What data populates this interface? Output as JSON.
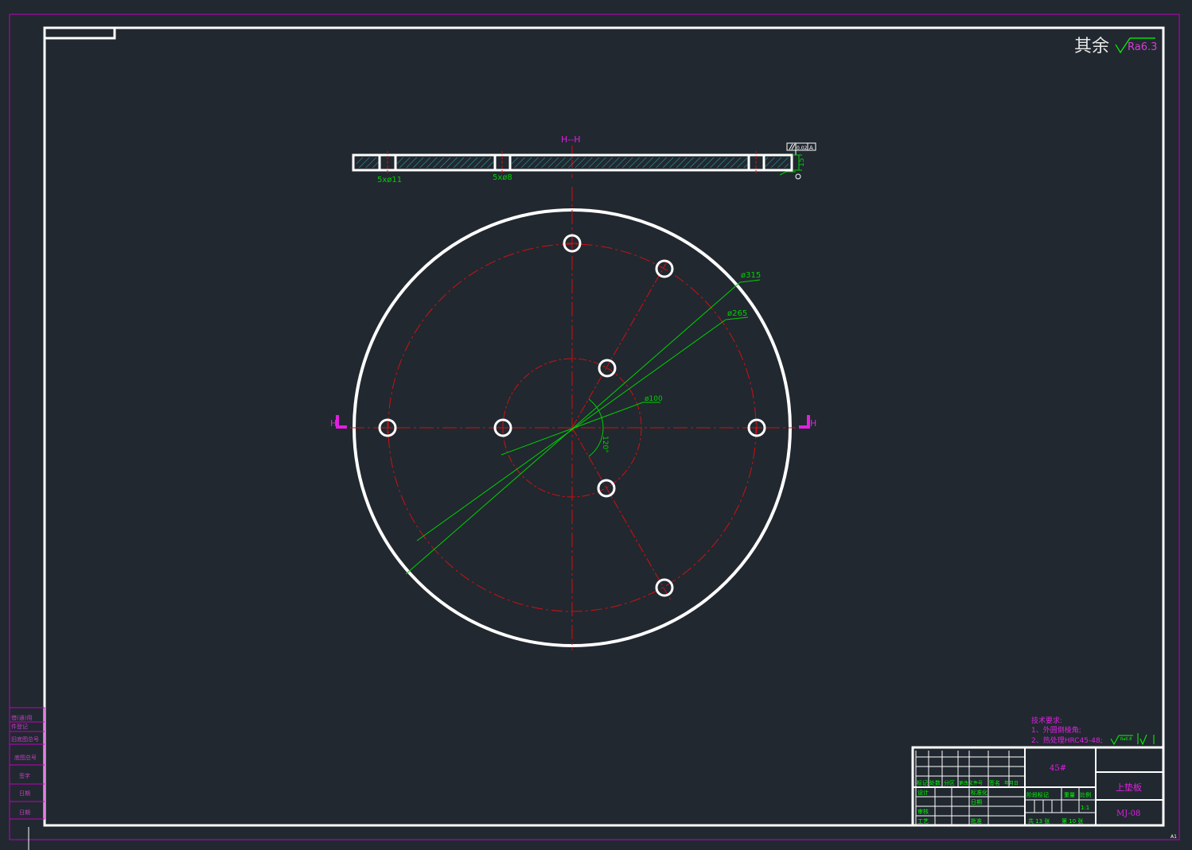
{
  "drawing": {
    "section_label": "H--H",
    "surface_note": {
      "prefix": "其余",
      "roughness": "Ra6.3"
    },
    "section_dims": {
      "hole_callout_left": "5xø11",
      "hole_callout_mid": "5xø8",
      "thickness": "15",
      "flatness_value": "0.02",
      "datum": "A"
    },
    "plan_dims": {
      "outer_diameter": "ø315",
      "pitch_diameter": "ø265",
      "inner_diameter": "ø100",
      "angle": "120°"
    },
    "cut_marker_left": "H",
    "cut_marker_right": "H"
  },
  "tech_requirements": {
    "title": "技术要求:",
    "items": [
      "1、外圆倒棱角;",
      "2、热处理HRC45-48;"
    ],
    "roughness_symbol": "Ra0.8"
  },
  "title_block": {
    "material": "45#",
    "part_name": "上垫板",
    "drawing_number": "MJ-08",
    "scale": "1:1",
    "sheet_total": "共 13 张",
    "sheet_no": "第 10 张",
    "row_labels": [
      "设计",
      "审核",
      "工艺"
    ],
    "mid_labels": [
      "标准化",
      "批准",
      "日期"
    ],
    "header_cells": [
      "标记",
      "处数",
      "分区",
      "更改文件号",
      "签名",
      "年月日"
    ],
    "stage_labels": [
      "阶段标记",
      "重量",
      "比例"
    ]
  },
  "side_stamps": [
    "借(通)用",
    "件登记",
    "旧底图总号",
    "底图总号",
    "签字",
    "日期",
    "日期"
  ],
  "sheet_size": "A1"
}
